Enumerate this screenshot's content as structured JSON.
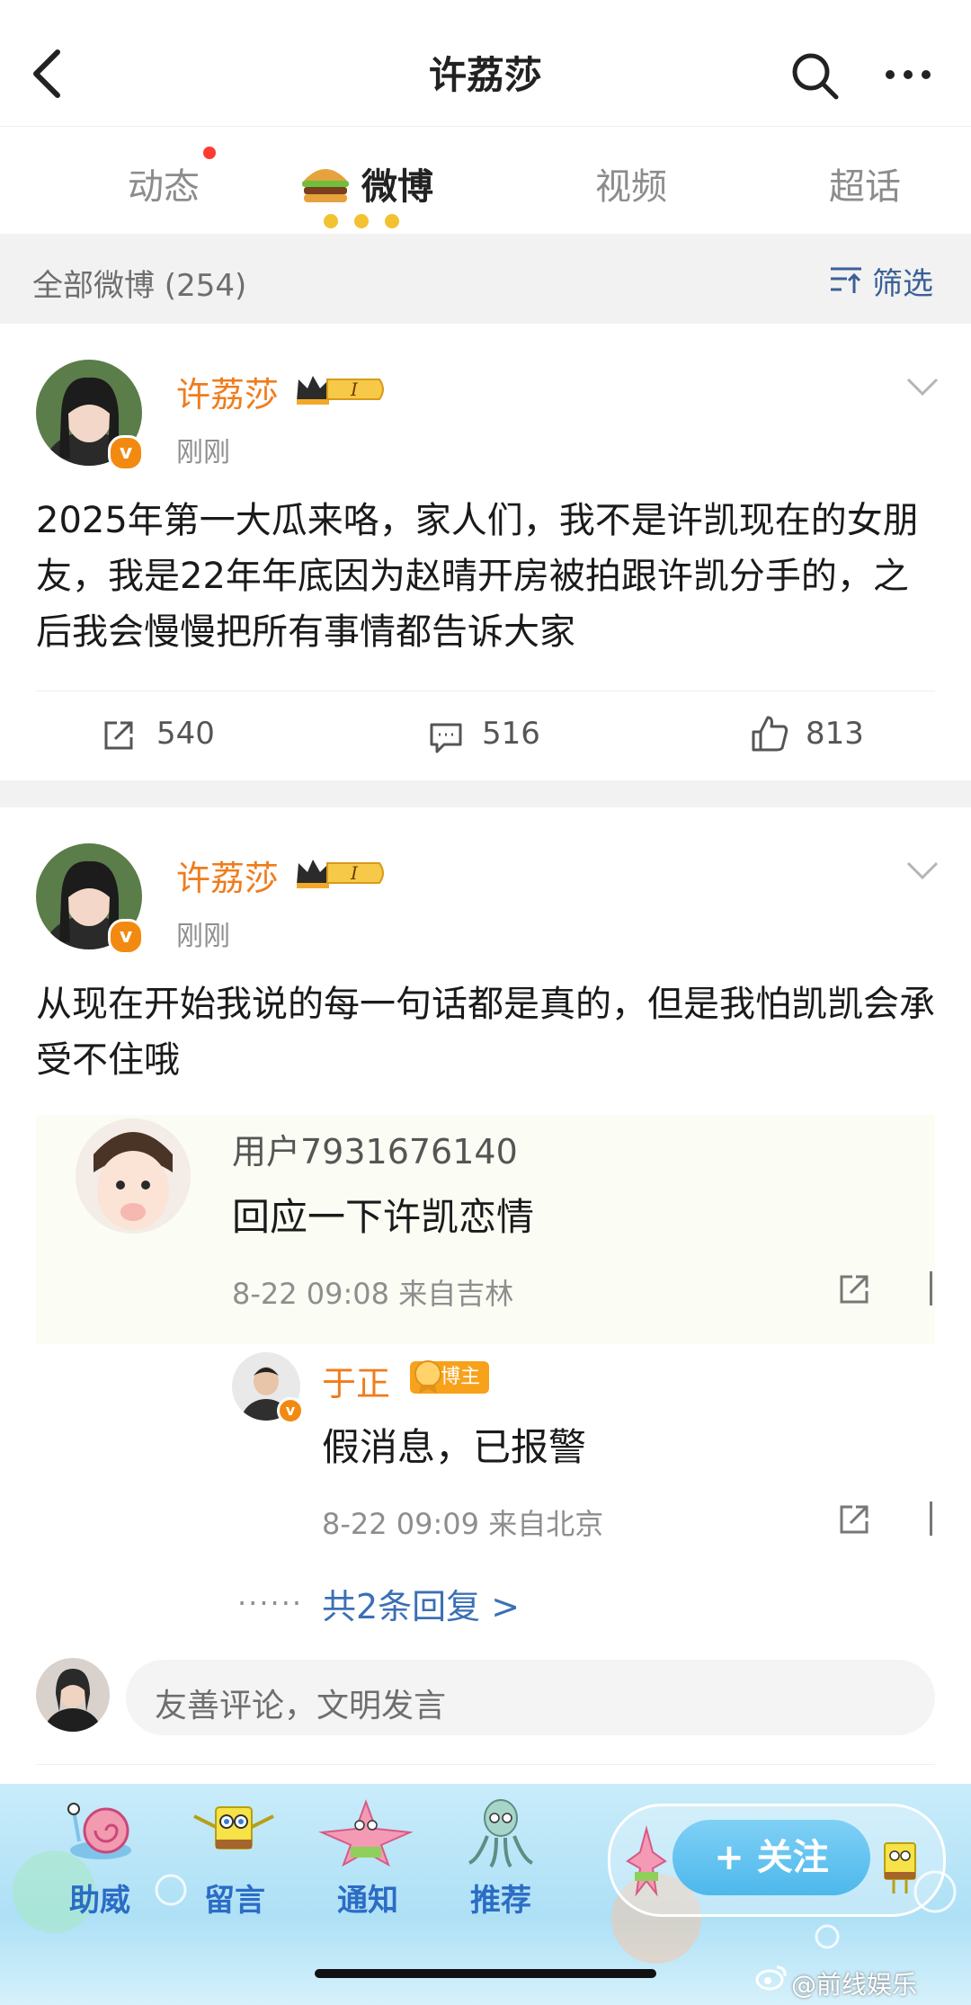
{
  "header": {
    "title": "许荔莎"
  },
  "tabs": [
    {
      "label": "动态",
      "has_dot": true
    },
    {
      "label": "微博",
      "active": true
    },
    {
      "label": "视频"
    },
    {
      "label": "超话"
    }
  ],
  "filter": {
    "count_label": "全部微博 (254)",
    "filter_label": "筛选"
  },
  "posts": [
    {
      "username": "许荔莎",
      "level": "I",
      "time": "刚刚",
      "text": "2025年第一大瓜来咯，家人们，我不是许凯现在的女朋友，我是22年年底因为赵晴开房被拍跟许凯分手的，之后我会慢慢把所有事情都告诉大家",
      "reposts": "540",
      "comments": "516",
      "likes": "813"
    },
    {
      "username": "许荔莎",
      "level": "I",
      "time": "刚刚",
      "text": "从现在开始我说的每一句话都是真的，但是我怕凯凯会承受不住哦"
    }
  ],
  "comment": {
    "user": "用户7931676140",
    "text": "回应一下许凯恋情",
    "meta": "8-22 09:08  来自吉林",
    "reply": {
      "user": "于正",
      "badge": "博主",
      "text": "假消息，已报警",
      "meta": "8-22 09:09  来自北京"
    },
    "more_replies": "共2条回复 >",
    "dots": "······"
  },
  "comment_input": {
    "placeholder": "友善评论，文明发言"
  },
  "bottom_nav": {
    "items": [
      "助威",
      "留言",
      "通知",
      "推荐"
    ],
    "follow": "+ 关注"
  },
  "watermark": "@前线娱乐"
}
